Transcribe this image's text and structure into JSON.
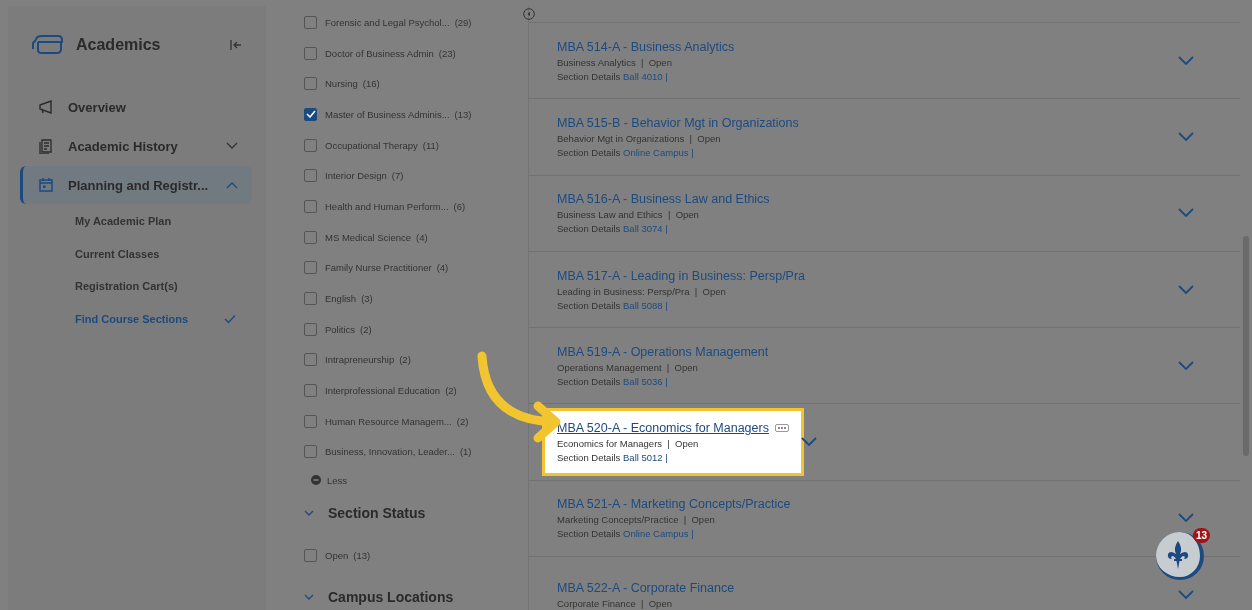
{
  "sidebar": {
    "title": "Academics",
    "items": [
      {
        "label": "Overview",
        "kind": "link",
        "selected": false
      },
      {
        "label": "Academic History",
        "kind": "group",
        "expanded": false,
        "selected": false
      },
      {
        "label": "Planning and Registr...",
        "kind": "group",
        "expanded": true,
        "selected": true,
        "children": [
          {
            "label": "My Academic Plan",
            "selected": false
          },
          {
            "label": "Current Classes",
            "selected": false
          },
          {
            "label": "Registration Cart(s)",
            "selected": false
          },
          {
            "label": "Find Course Sections",
            "selected": true
          }
        ]
      }
    ]
  },
  "filters": {
    "programs": [
      {
        "label": "Forensic and Legal Psychol...",
        "count": "(29)",
        "checked": false
      },
      {
        "label": "Doctor of Business Admin",
        "count": "(23)",
        "checked": false
      },
      {
        "label": "Nursing",
        "count": "(16)",
        "checked": false
      },
      {
        "label": "Master of Business Adminis...",
        "count": "(13)",
        "checked": true
      },
      {
        "label": "Occupational Therapy",
        "count": "(11)",
        "checked": false
      },
      {
        "label": "Interior Design",
        "count": "(7)",
        "checked": false
      },
      {
        "label": "Health and Human Perform...",
        "count": "(6)",
        "checked": false
      },
      {
        "label": "MS Medical Science",
        "count": "(4)",
        "checked": false
      },
      {
        "label": "Family Nurse Practitioner",
        "count": "(4)",
        "checked": false
      },
      {
        "label": "English",
        "count": "(3)",
        "checked": false
      },
      {
        "label": "Politics",
        "count": "(2)",
        "checked": false
      },
      {
        "label": "Intrapreneurship",
        "count": "(2)",
        "checked": false
      },
      {
        "label": "Interprofessional Education",
        "count": "(2)",
        "checked": false
      },
      {
        "label": "Human Resource Managem...",
        "count": "(2)",
        "checked": false
      },
      {
        "label": "Business, Innovation, Leader...",
        "count": "(1)",
        "checked": false
      }
    ],
    "less_label": "Less",
    "sections": [
      {
        "title": "Section Status",
        "expanded": true,
        "options": [
          {
            "label": "Open",
            "count": "(13)",
            "checked": false
          }
        ]
      },
      {
        "title": "Campus Locations",
        "expanded": true
      }
    ]
  },
  "courses": [
    {
      "title": "MBA 514-A - Business Analytics",
      "subtitle": "Business Analytics",
      "separator": "|",
      "status": "Open",
      "details_label": "Section Details",
      "location": "Ball 4010 |",
      "highlighted": false
    },
    {
      "title": "MBA 515-B - Behavior Mgt in Organizations",
      "subtitle": "Behavior Mgt in Organizations",
      "separator": "|",
      "status": "Open",
      "details_label": "Section Details",
      "location": "Online Campus |",
      "highlighted": false
    },
    {
      "title": "MBA 516-A - Business Law and Ethics",
      "subtitle": "Business Law and Ethics",
      "separator": "|",
      "status": "Open",
      "details_label": "Section Details",
      "location": "Ball 3074 |",
      "highlighted": false
    },
    {
      "title": "MBA 517-A - Leading in Business: Persp/Pra",
      "subtitle": "Leading in Business: Persp/Pra",
      "separator": "|",
      "status": "Open",
      "details_label": "Section Details",
      "location": "Ball 5088 |",
      "highlighted": false
    },
    {
      "title": "MBA 519-A - Operations Management",
      "subtitle": "Operations Management",
      "separator": "|",
      "status": "Open",
      "details_label": "Section Details",
      "location": "Ball 5036 |",
      "highlighted": false
    },
    {
      "title": "MBA 520-A - Economics for Managers",
      "subtitle": "Economics for Managers",
      "separator": "|",
      "status": "Open",
      "details_label": "Section Details",
      "location": "Ball 5012 |",
      "highlighted": true
    },
    {
      "title": "MBA 521-A - Marketing Concepts/Practice",
      "subtitle": "Marketing Concepts/Practice",
      "separator": "|",
      "status": "Open",
      "details_label": "Section Details",
      "location": "Online Campus |",
      "highlighted": false
    },
    {
      "title": "MBA 522-A - Corporate Finance",
      "subtitle": "Corporate Finance",
      "separator": "|",
      "status": "Open",
      "highlighted": false
    }
  ],
  "chat": {
    "badge": "13"
  }
}
